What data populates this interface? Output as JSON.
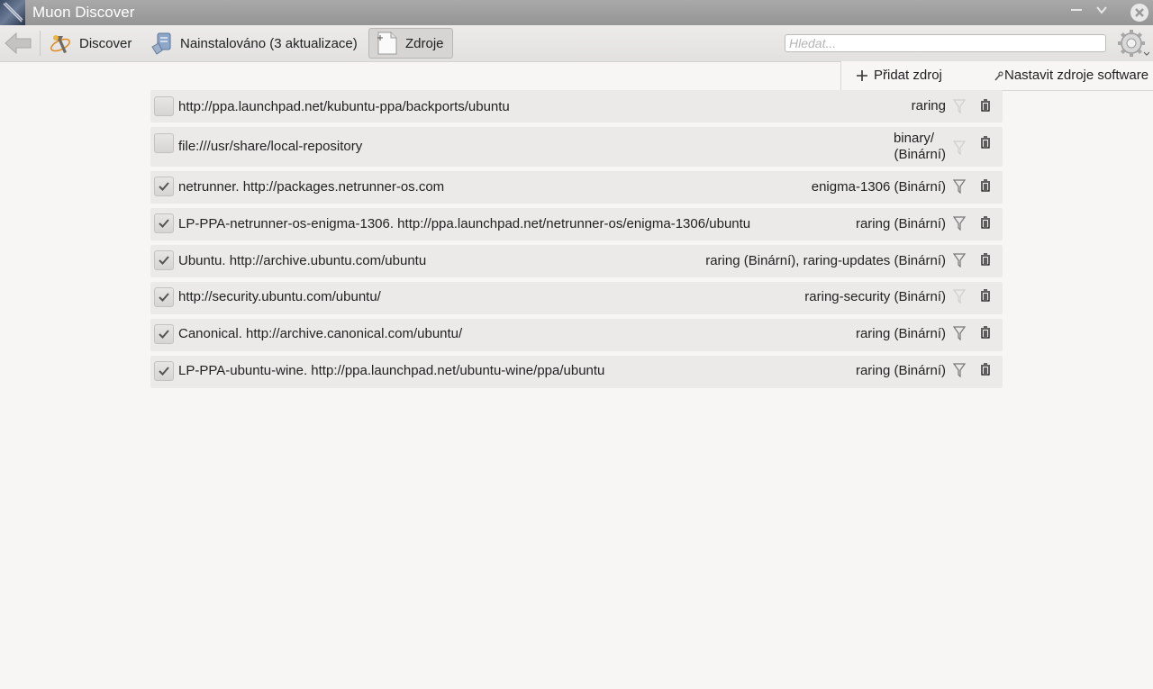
{
  "window": {
    "title": "Muon Discover"
  },
  "toolbar": {
    "discover_label": "Discover",
    "installed_label": "Nainstalováno (3 aktualizace)",
    "sources_label": "Zdroje",
    "search_placeholder": "Hledat..."
  },
  "actions": {
    "add_source": "Přidat zdroj",
    "configure_sources": "Nastavit zdroje software"
  },
  "sources": [
    {
      "name": "http://ppa.launchpad.net/kubuntu-ppa/backports/ubuntu",
      "suites": "raring",
      "enabled": false
    },
    {
      "name": "file:///usr/share/local-repository",
      "suites_line1": "binary/",
      "suites_line2": "(Binární)",
      "enabled": false
    },
    {
      "name": "netrunner. http://packages.netrunner-os.com",
      "suites": "enigma-1306 (Binární)",
      "enabled": true
    },
    {
      "name": "LP-PPA-netrunner-os-enigma-1306. http://ppa.launchpad.net/netrunner-os/enigma-1306/ubuntu",
      "suites": "raring (Binární)",
      "enabled": true
    },
    {
      "name": "Ubuntu. http://archive.ubuntu.com/ubuntu",
      "suites": "raring (Binární), raring-updates (Binární)",
      "enabled": true
    },
    {
      "name": "http://security.ubuntu.com/ubuntu/",
      "suites": "raring-security (Binární)",
      "enabled": true
    },
    {
      "name": "Canonical. http://archive.canonical.com/ubuntu/",
      "suites": "raring (Binární)",
      "enabled": true
    },
    {
      "name": "LP-PPA-ubuntu-wine. http://ppa.launchpad.net/ubuntu-wine/ppa/ubuntu",
      "suites": "raring (Binární)",
      "enabled": true
    }
  ]
}
